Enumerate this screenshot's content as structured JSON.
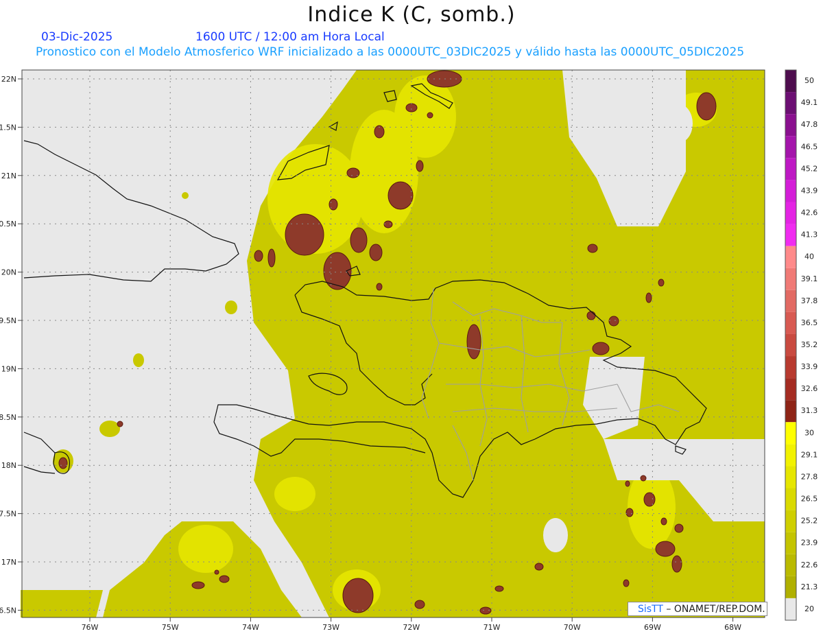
{
  "title": "Indice K (C, somb.)",
  "date": "03-Dic-2025",
  "valid_time": "1600 UTC / 12:00 am Hora Local",
  "subtitle": "Pronostico con el Modelo Atmosferico WRF inicializado a las 0000UTC_03DIC2025 y válido hasta las  0000UTC_05DIC2025",
  "lat_labels": [
    "22N",
    "21.5N",
    "21N",
    "20.5N",
    "20N",
    "19.5N",
    "19N",
    "18.5N",
    "18N",
    "17.5N",
    "17N",
    "16.5N"
  ],
  "lon_labels": [
    "76W",
    "75W",
    "74W",
    "73W",
    "72W",
    "71W",
    "70W",
    "69W",
    "68W"
  ],
  "colorbar": {
    "labels": [
      "50",
      "49.1",
      "47.8",
      "46.5",
      "45.2",
      "43.9",
      "42.6",
      "41.3",
      "40",
      "39.1",
      "37.8",
      "36.5",
      "35.2",
      "33.9",
      "32.6",
      "31.3",
      "30",
      "29.1",
      "27.8",
      "26.5",
      "25.2",
      "23.9",
      "22.6",
      "21.3",
      "20"
    ],
    "colors": [
      "#4e0d4e",
      "#6c0f73",
      "#8a108f",
      "#a415ab",
      "#be19c4",
      "#d41ed8",
      "#e424e4",
      "#f02cf0",
      "#ff8a8a",
      "#f07a76",
      "#e26a63",
      "#d85a52",
      "#c94a40",
      "#b83a2f",
      "#a52c22",
      "#8e2416",
      "#ffff00",
      "#f2f200",
      "#e6e600",
      "#dada00",
      "#cfcf00",
      "#c4c400",
      "#baba00",
      "#b0b000",
      "#e8e8e8"
    ]
  },
  "credit": {
    "sis": "SisTT",
    "text": "– ONAMET/REP.DOM."
  }
}
